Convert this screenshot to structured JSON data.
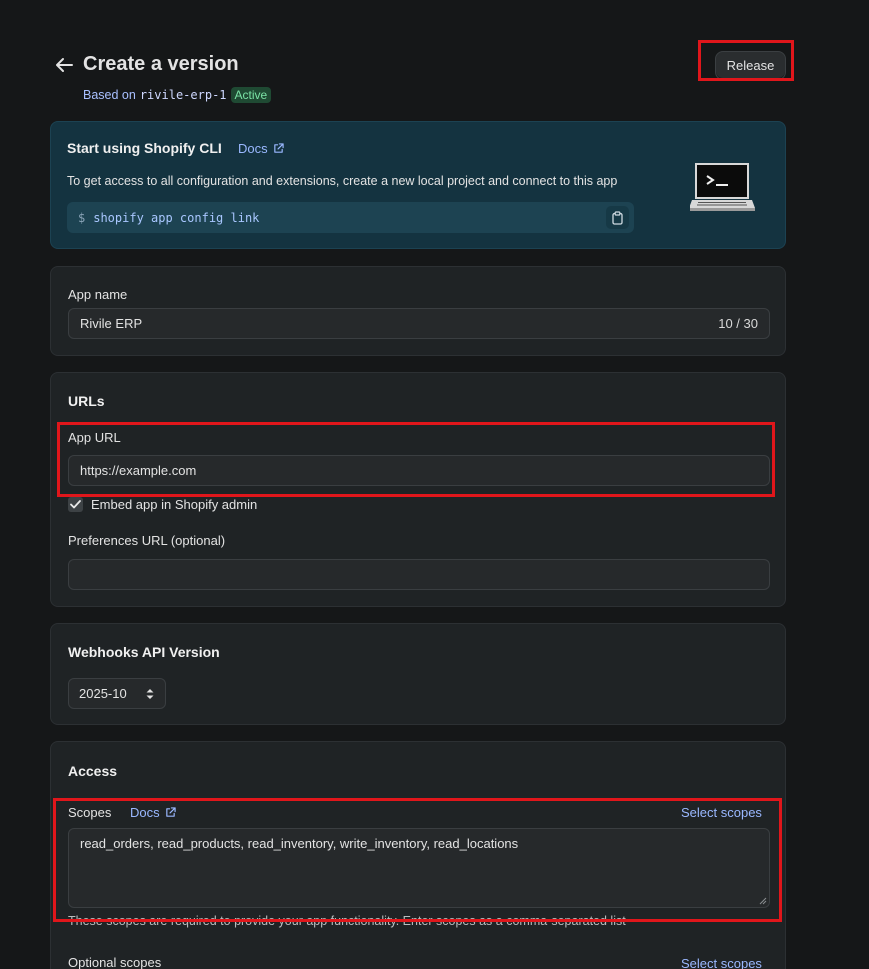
{
  "header": {
    "title": "Create a version",
    "based_on_prefix": "Based on",
    "based_on_version": "rivile-erp-1",
    "status_badge": "Active",
    "release_label": "Release"
  },
  "cli": {
    "title": "Start using Shopify CLI",
    "docs_label": "Docs",
    "description": "To get access to all configuration and extensions, create a new local project and connect to this app",
    "prompt": "$",
    "command": "shopify app config link"
  },
  "app_name": {
    "label": "App name",
    "value": "Rivile ERP",
    "counter": "10 / 30"
  },
  "urls": {
    "title": "URLs",
    "app_url_label": "App URL",
    "app_url_value": "https://example.com",
    "embed_label": "Embed app in Shopify admin",
    "embed_checked": true,
    "preferences_label": "Preferences URL (optional)",
    "preferences_value": ""
  },
  "webhooks": {
    "title": "Webhooks API Version",
    "selected_version": "2025-10"
  },
  "access": {
    "title": "Access",
    "scopes_label": "Scopes",
    "docs_label": "Docs",
    "select_scopes_label": "Select scopes",
    "scopes_value": "read_orders, read_products, read_inventory, write_inventory, read_locations",
    "help_text": "These scopes are required to provide your app functionality. Enter scopes as a comma-separated list",
    "optional_scopes_label": "Optional scopes",
    "optional_select_scopes_label": "Select scopes"
  },
  "colors": {
    "background": "#151718",
    "card": "#1f2325",
    "cli_card": "#143340",
    "link": "#9ab8ff",
    "highlight": "#e0161b",
    "active_badge": "#7be3a6"
  }
}
